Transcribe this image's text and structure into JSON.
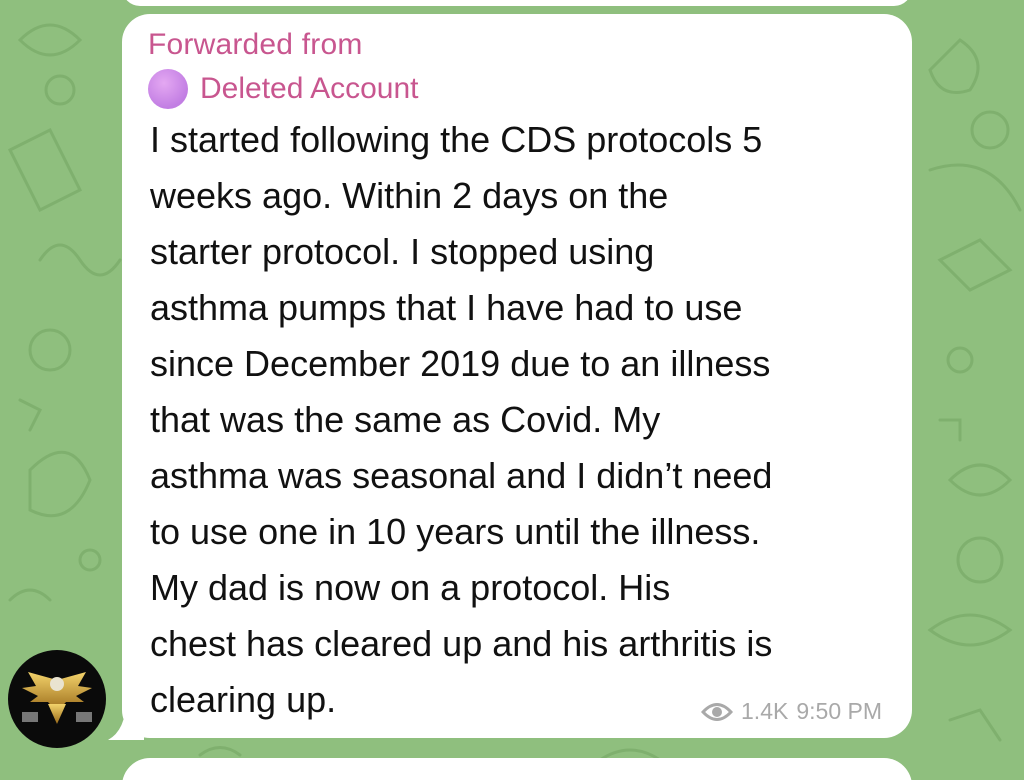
{
  "message": {
    "forwarded_label": "Forwarded from",
    "forwarded_source": "Deleted Account",
    "text": "I started following the CDS protocols 5\nweeks ago.  Within 2 days on the\nstarter protocol.  I stopped using\nasthma pumps that I have had to use\nsince December 2019 due to an illness\nthat was the same as Covid.  My\nasthma was seasonal and I didn’t need\nto use one in 10 years until the illness.\nMy dad is now on a protocol.  His\nchest has cleared up and his arthritis is\nclearing up.",
    "views": "1.4K",
    "time": "9:50 PM"
  },
  "icons": {
    "views": "eye-icon",
    "channel_avatar": "eagle-emblem-icon"
  },
  "colors": {
    "background": "#8fbf7e",
    "bubble": "#ffffff",
    "forward_accent": "#c8568f",
    "meta": "#a9a9a9"
  }
}
